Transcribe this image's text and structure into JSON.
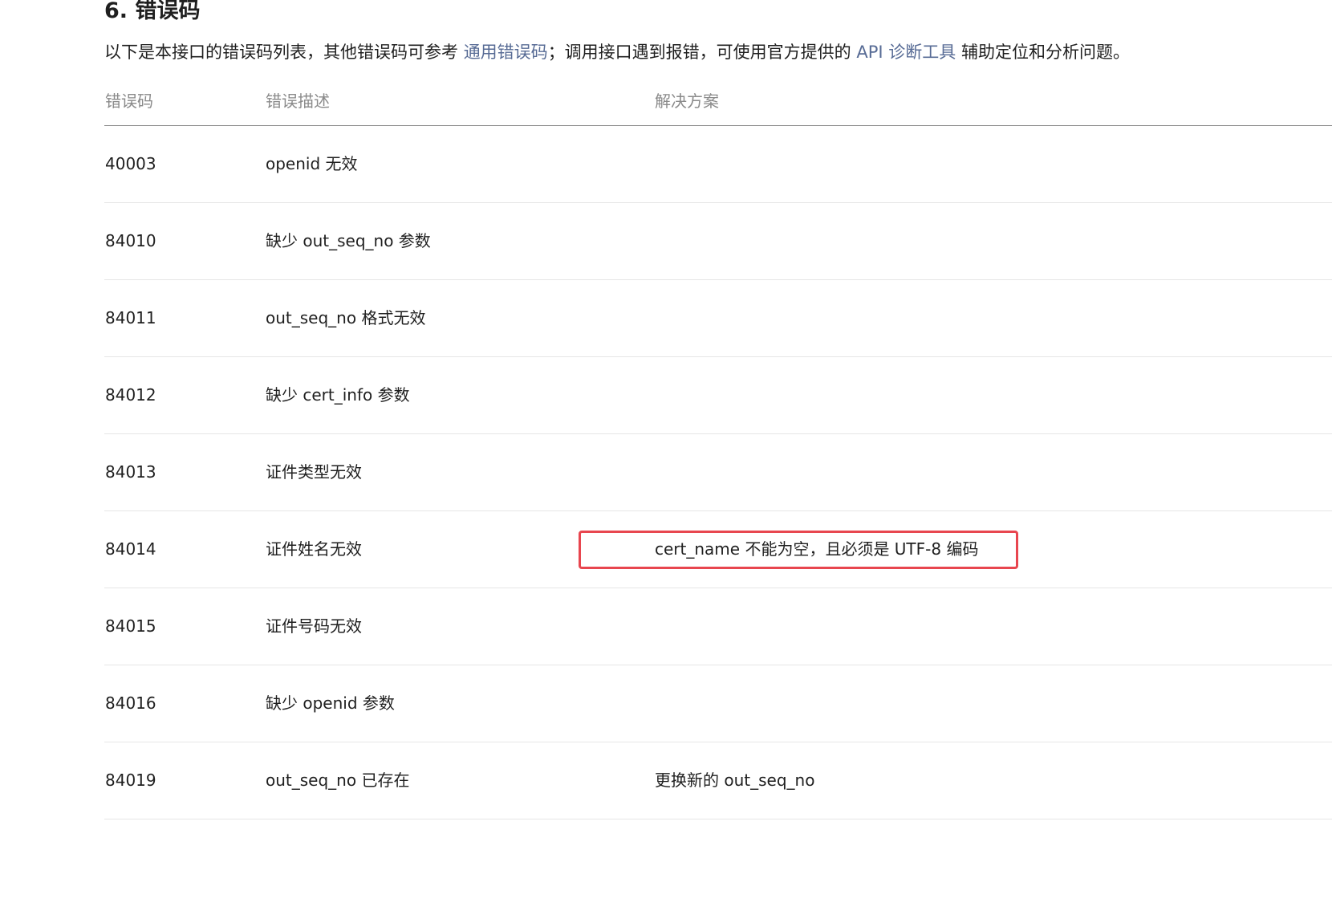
{
  "section": {
    "title": "6. 错误码"
  },
  "intro": {
    "text_before": "以下是本接口的错误码列表，其他错误码可参考 ",
    "link_common_codes": "通用错误码",
    "text_middle": "；调用接口遇到报错，可使用官方提供的 ",
    "link_api_tool": "API 诊断工具",
    "text_after": " 辅助定位和分析问题。"
  },
  "table": {
    "headers": {
      "code": "错误码",
      "description": "错误描述",
      "solution": "解决方案"
    },
    "rows": [
      {
        "code": "40003",
        "description": "openid 无效",
        "solution": ""
      },
      {
        "code": "84010",
        "description": "缺少 out_seq_no 参数",
        "solution": ""
      },
      {
        "code": "84011",
        "description": "out_seq_no 格式无效",
        "solution": ""
      },
      {
        "code": "84012",
        "description": "缺少 cert_info 参数",
        "solution": ""
      },
      {
        "code": "84013",
        "description": "证件类型无效",
        "solution": ""
      },
      {
        "code": "84014",
        "description": "证件姓名无效",
        "solution": "cert_name 不能为空，且必须是 UTF-8 编码"
      },
      {
        "code": "84015",
        "description": "证件号码无效",
        "solution": ""
      },
      {
        "code": "84016",
        "description": "缺少 openid 参数",
        "solution": ""
      },
      {
        "code": "84019",
        "description": "out_seq_no 已存在",
        "solution": "更换新的 out_seq_no"
      }
    ]
  },
  "colors": {
    "link": "#576b95",
    "highlight": "#e8464f",
    "header_text": "#8a8a8a"
  }
}
